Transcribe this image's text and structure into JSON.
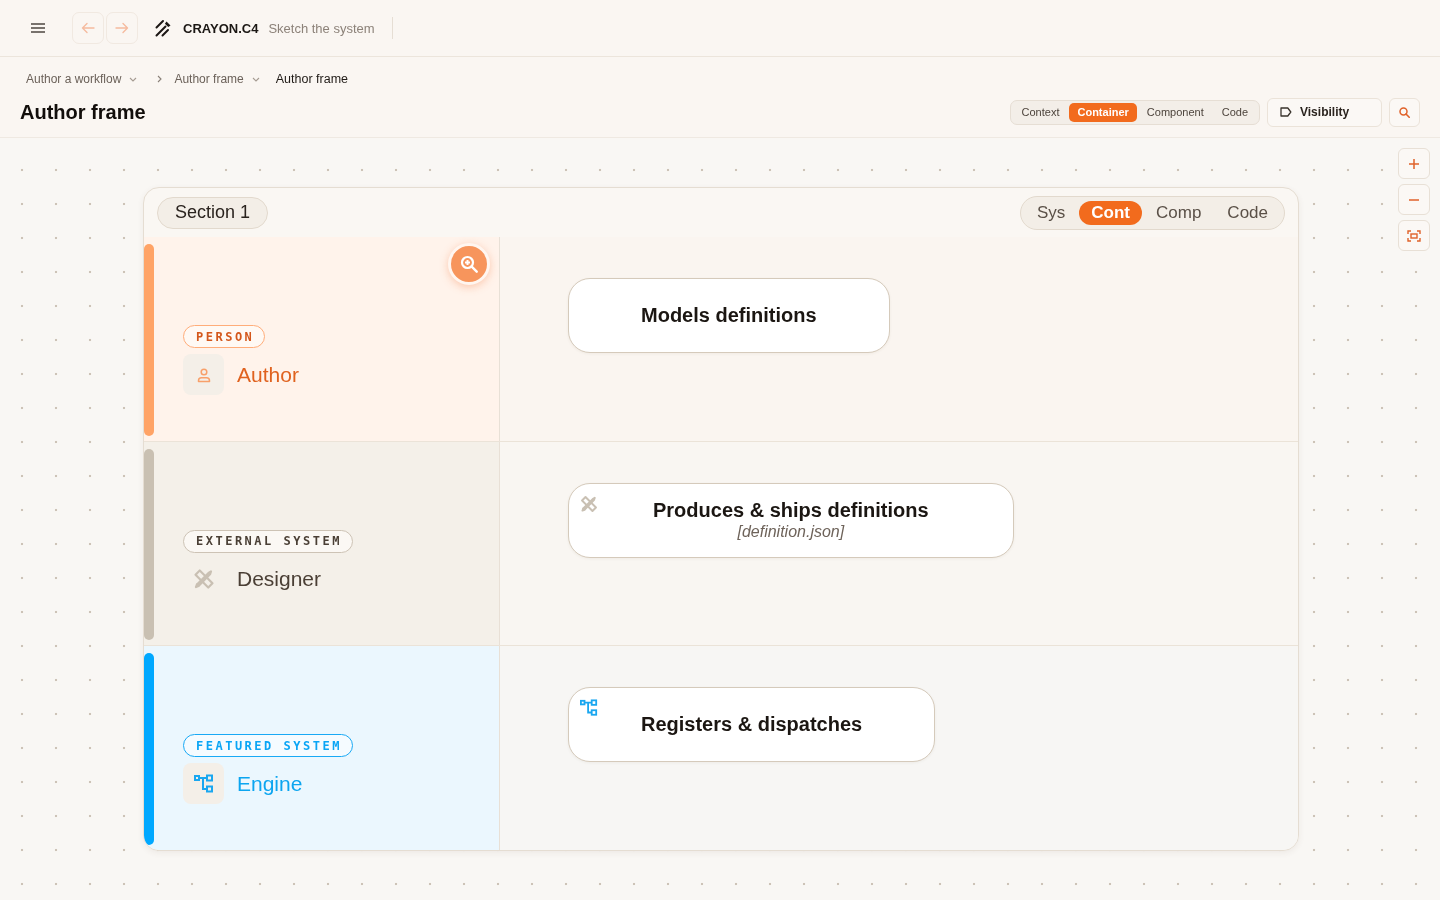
{
  "app_bar": {
    "history_buttons": [
      {
        "kind": "back",
        "disabled": true
      },
      {
        "kind": "forward",
        "disabled": true
      }
    ],
    "app_name": "CRAYON.C4",
    "tagline": "Sketch the system"
  },
  "breadcrumbs": {
    "path": [
      {
        "label": "Author a workflow"
      },
      {
        "label": "Author frame"
      }
    ],
    "current": "Author frame"
  },
  "page_title": "Author frame",
  "level_tabs": [
    {
      "label": "Context",
      "selected": false
    },
    {
      "label": "Container",
      "selected": true
    },
    {
      "label": "Component",
      "selected": false
    },
    {
      "label": "Code",
      "selected": false
    }
  ],
  "visibility_button": {
    "label": "Visibility"
  },
  "frame": {
    "title": "Section 1",
    "level_tabs": [
      {
        "label": "Sys",
        "selected": false
      },
      {
        "label": "Cont",
        "selected": true
      },
      {
        "label": "Comp",
        "selected": false
      },
      {
        "label": "Code",
        "selected": false
      }
    ],
    "lanes": [
      {
        "kind": "person",
        "badge": "PERSON",
        "name": "Author",
        "color": "#ffa366",
        "zoom_button": true,
        "cards": [
          {
            "title": "Models definitions"
          }
        ]
      },
      {
        "kind": "external",
        "badge": "EXTERNAL SYSTEM",
        "name": "Designer",
        "color": "#c9c0b2",
        "zoom_button": false,
        "cards": [
          {
            "title": "Produces & ships definitions",
            "technology": "[definition.json]"
          }
        ]
      },
      {
        "kind": "featured",
        "badge": "FEATURED SYSTEM",
        "name": "Engine",
        "color": "#00a8ff",
        "zoom_button": false,
        "cards": [
          {
            "title": "Registers & dispatches"
          }
        ]
      }
    ]
  }
}
